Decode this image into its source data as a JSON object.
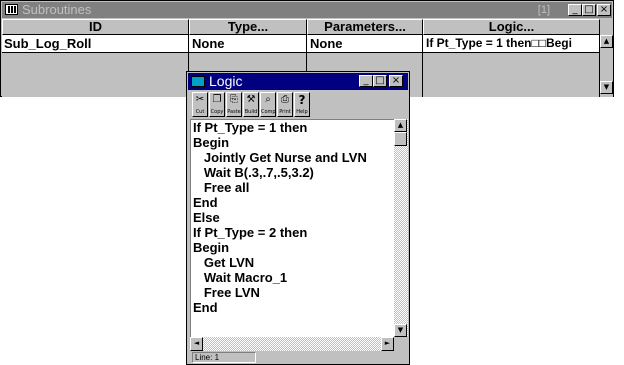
{
  "subroutines_window": {
    "title": "Subroutines",
    "record_counter": "[1]",
    "columns": [
      "ID",
      "Type...",
      "Parameters...",
      "Logic..."
    ],
    "rows": [
      {
        "id": "Sub_Log_Roll",
        "type": "None",
        "parameters": "None",
        "logic": "If Pt_Type = 1 then□□Begi"
      }
    ]
  },
  "logic_window": {
    "title": "Logic",
    "toolbar": [
      {
        "label": "Cut",
        "icon": "scissors-icon",
        "glyph": "✂"
      },
      {
        "label": "Copy",
        "icon": "copy-icon",
        "glyph": "❐"
      },
      {
        "label": "Paste",
        "icon": "paste-icon",
        "glyph": "⎘"
      },
      {
        "label": "Build",
        "icon": "build-icon",
        "glyph": "⚒"
      },
      {
        "label": "Comp",
        "icon": "compile-icon",
        "glyph": "⌕"
      },
      {
        "label": "Print",
        "icon": "printer-icon",
        "glyph": "⎙"
      },
      {
        "label": "Help",
        "icon": "help-icon",
        "glyph": "?"
      }
    ],
    "code_lines": [
      "If Pt_Type = 1 then",
      "Begin",
      "   Jointly Get Nurse and LVN",
      "   Wait B(.3,.7,.5,3.2)",
      "   Free all",
      "End",
      "Else",
      "If Pt_Type = 2 then",
      "Begin",
      "   Get LVN",
      "   Wait Macro_1",
      "   Free LVN",
      "End"
    ],
    "status_line": "Line: 1"
  }
}
